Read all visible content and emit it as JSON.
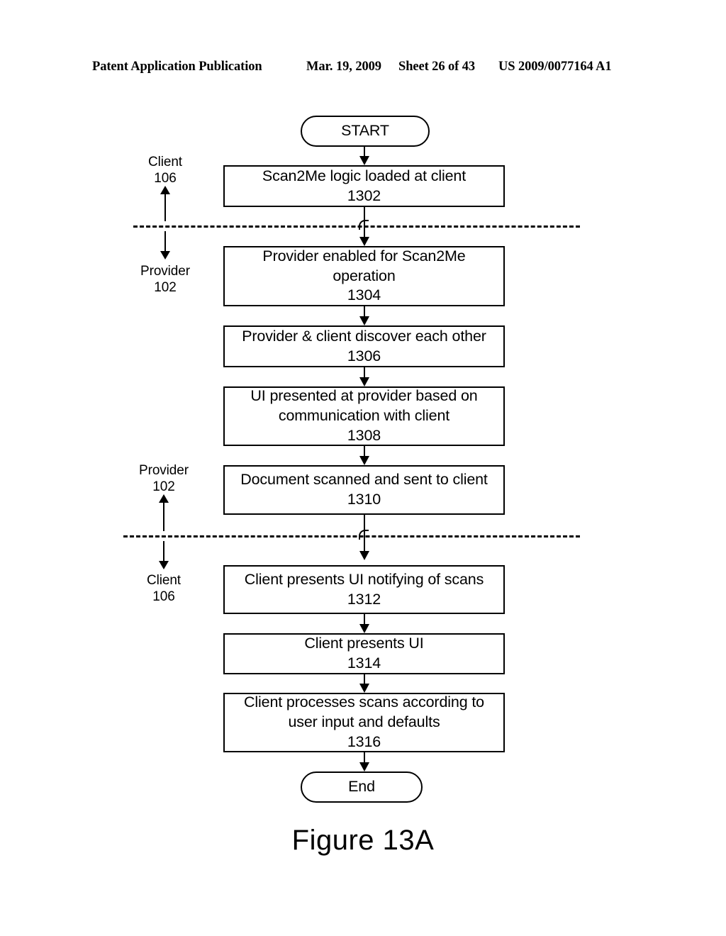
{
  "header": {
    "publication": "Patent Application Publication",
    "date": "Mar. 19, 2009",
    "sheet": "Sheet 26 of 43",
    "patent_number": "US 2009/0077164 A1"
  },
  "figure": {
    "caption": "Figure 13A"
  },
  "flowchart": {
    "start": {
      "label": "START"
    },
    "end": {
      "label": "End"
    },
    "steps": [
      {
        "text": "Scan2Me logic loaded at client",
        "ref": "1302"
      },
      {
        "text_line1": "Provider enabled for Scan2Me",
        "text_line2": "operation",
        "ref": "1304"
      },
      {
        "text": "Provider & client discover each other",
        "ref": "1306"
      },
      {
        "text_line1": "UI presented at provider based on",
        "text_line2": "communication with client",
        "ref": "1308"
      },
      {
        "text": "Document scanned and sent to client",
        "ref": "1310"
      },
      {
        "text": "Client presents UI notifying of scans",
        "ref": "1312"
      },
      {
        "text": "Client presents UI",
        "ref": "1314"
      },
      {
        "text_line1": "Client processes scans according to",
        "text_line2": "user input and defaults",
        "ref": "1316"
      }
    ],
    "lanes": [
      {
        "above_name": "Client",
        "above_ref": "106",
        "below_name": "Provider",
        "below_ref": "102"
      },
      {
        "above_name": "Provider",
        "above_ref": "102",
        "below_name": "Client",
        "below_ref": "106"
      }
    ]
  }
}
